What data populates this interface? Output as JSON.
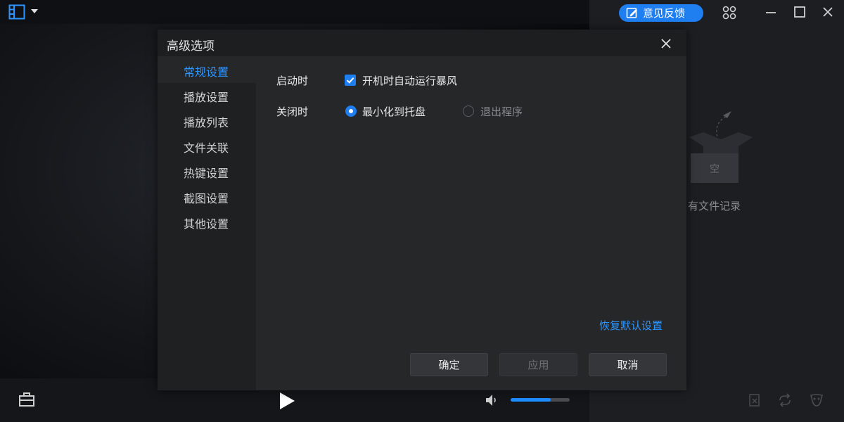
{
  "app": {
    "feedback_label": "意见反馈",
    "accent_color": "#1f7ff0",
    "volume_level": 0.68
  },
  "right_panel": {
    "empty_box_label": "空",
    "empty_text": "有文件记录"
  },
  "dialog": {
    "title": "高级选项",
    "sidebar": [
      {
        "label": "常规设置",
        "active": true
      },
      {
        "label": "播放设置",
        "active": false
      },
      {
        "label": "播放列表",
        "active": false
      },
      {
        "label": "文件关联",
        "active": false
      },
      {
        "label": "热键设置",
        "active": false
      },
      {
        "label": "截图设置",
        "active": false
      },
      {
        "label": "其他设置",
        "active": false
      }
    ],
    "startup": {
      "label": "启动时",
      "autorun_label": "开机时自动运行暴风",
      "autorun_checked": true
    },
    "close": {
      "label": "关闭时",
      "options": [
        {
          "label": "最小化到托盘",
          "selected": true
        },
        {
          "label": "退出程序",
          "selected": false
        }
      ]
    },
    "restore_defaults": "恢复默认设置",
    "buttons": {
      "ok": "确定",
      "apply": "应用",
      "cancel": "取消"
    }
  }
}
